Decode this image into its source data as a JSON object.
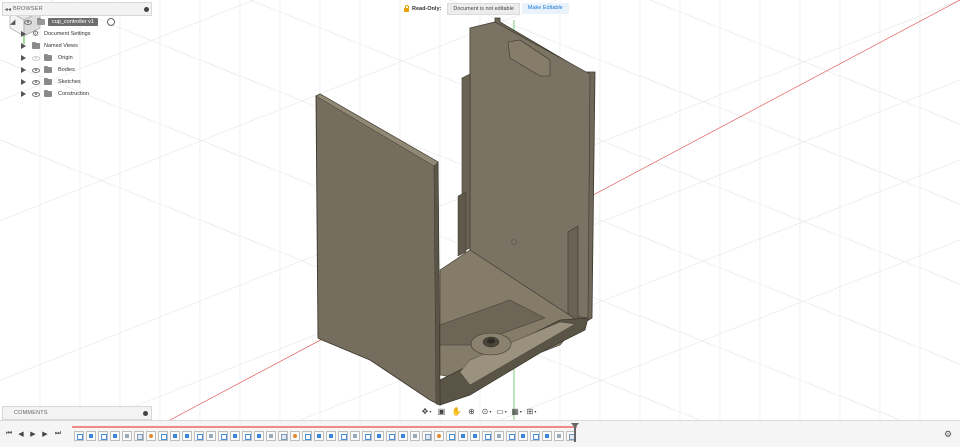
{
  "browser": {
    "title": "BROWSER",
    "root": "cup_controller v1",
    "items": [
      {
        "label": "Document Settings",
        "icon": "gear-icon",
        "eye": false
      },
      {
        "label": "Named Views",
        "icon": "folder-icon",
        "eye": false
      },
      {
        "label": "Origin",
        "icon": "folder-icon",
        "eye": true,
        "eye_faded": true
      },
      {
        "label": "Bodies",
        "icon": "folder-icon",
        "eye": true,
        "eye_faded": false
      },
      {
        "label": "Sketches",
        "icon": "folder-icon",
        "eye": true,
        "eye_faded": false
      },
      {
        "label": "Construction",
        "icon": "folder-icon",
        "eye": true,
        "eye_faded": false
      }
    ]
  },
  "banner": {
    "read_only": "Read-Only:",
    "message": "Document is not editable",
    "action": "Make Editable"
  },
  "comments": {
    "title": "COMMENTS"
  },
  "navbar": {
    "tools": [
      "orbit-icon",
      "look-at-icon",
      "pan-icon",
      "zoom-icon",
      "zoom-window-icon",
      "display-settings-icon",
      "grid-settings-icon",
      "viewports-icon"
    ]
  },
  "timeline": {
    "controls": [
      "skip-to-start-icon",
      "step-back-icon",
      "play-icon",
      "step-forward-icon",
      "skip-to-end-icon"
    ],
    "feature_count": 42
  },
  "colors": {
    "accent": "#1b7bd6",
    "lock": "#e8a000",
    "model_face": "#756d5e",
    "x_axis": "#e05a5a",
    "y_axis": "#41b646",
    "timeline_bar": "#f08a8a"
  }
}
